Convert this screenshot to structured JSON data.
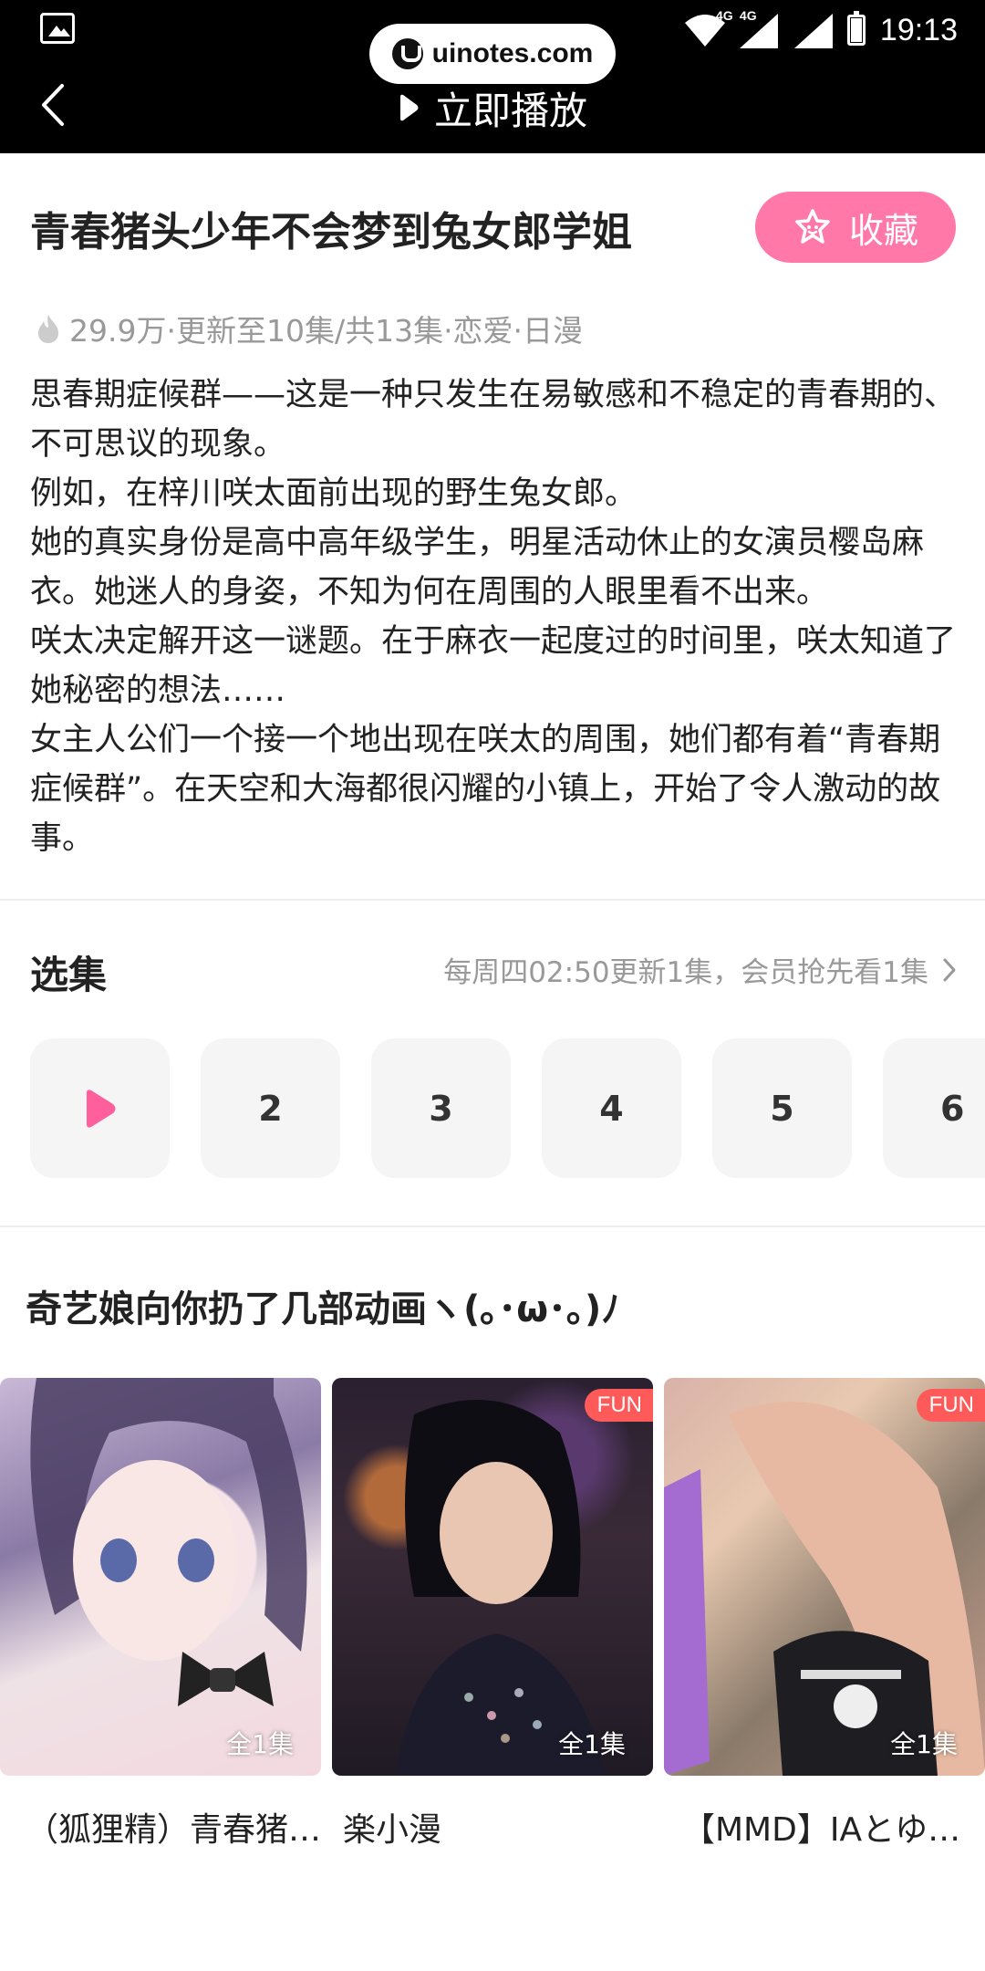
{
  "status_bar": {
    "time": "19:13",
    "net1": "4G",
    "net2": "4G",
    "icons": [
      "gallery-icon",
      "wifi-icon",
      "signal-icon",
      "battery-icon"
    ]
  },
  "watermark": {
    "text": "uinotes.com"
  },
  "header": {
    "play_label": "立即播放",
    "back_icon": "chevron-left-icon",
    "play_icon": "play-icon"
  },
  "show": {
    "title": "青春猪头少年不会梦到兔女郎学姐",
    "favorite_label": "收藏",
    "meta": "29.9万·更新至10集/共13集·恋爱·日漫",
    "description": [
      "思春期症候群——这是一种只发生在易敏感和不稳定的青春期的、不可思议的现象。",
      "例如，在梓川咲太面前出现的野生兔女郎。",
      "她的真实身份是高中高年级学生，明星活动休止的女演员樱岛麻衣。她迷人的身姿，不知为何在周围的人眼里看不出来。",
      "咲太决定解开这一谜题。在于麻衣一起度过的时间里，咲太知道了她秘密的想法……",
      "女主人公们一个接一个地出现在咲太的周围，她们都有着“青春期症候群”。在天空和大海都很闪耀的小镇上，开始了令人激动的故事。"
    ]
  },
  "episodes": {
    "title": "选集",
    "update_note": "每周四02:50更新1集，会员抢先看1集",
    "items": [
      "2",
      "3",
      "4",
      "5",
      "6"
    ]
  },
  "recommend": {
    "title": "奇艺娘向你扔了几部动画ヽ(｡･ω･｡)ﾉ",
    "cards": [
      {
        "title": "（狐狸精）青春猪…",
        "count": "全1集",
        "badge": ""
      },
      {
        "title": "楽小漫",
        "count": "全1集",
        "badge": "FUN"
      },
      {
        "title": "【MMD】IAとゆ…",
        "count": "全1集",
        "badge": "FUN"
      }
    ]
  },
  "colors": {
    "accent": "#ff78a8",
    "badge": "#ff5a5a",
    "muted": "#999999"
  }
}
